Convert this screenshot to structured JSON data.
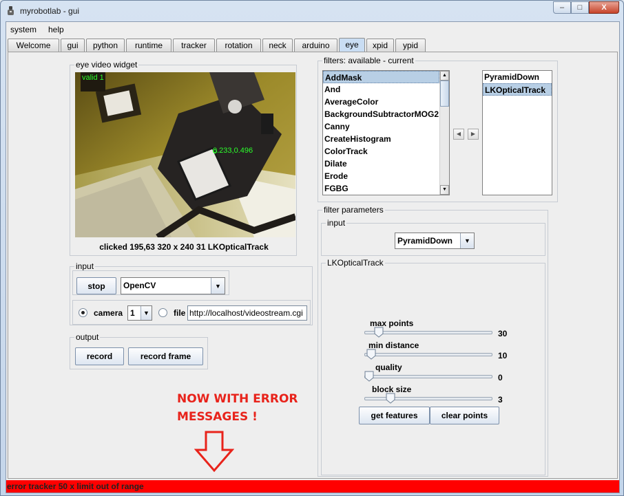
{
  "window": {
    "title": "myrobotlab - gui",
    "min_label": "–",
    "max_label": "□",
    "close_label": "X"
  },
  "menu": [
    "system",
    "help"
  ],
  "tabs": [
    "Welcome",
    "gui",
    "python",
    "runtime",
    "tracker",
    "rotation",
    "neck",
    "arduino",
    "eye",
    "xpid",
    "ypid"
  ],
  "active_tab": "eye",
  "video_widget": {
    "title": "eye  video widget",
    "overlay_valid": "valid 1",
    "overlay_point": "0.233,0.496",
    "info": "clicked 195,63  320 x 240  31  LKOpticalTrack"
  },
  "input": {
    "title": "input",
    "stop_label": "stop",
    "source_selected": "OpenCV",
    "camera_label": "camera",
    "camera_index": "1",
    "file_label": "file",
    "file_value": "http://localhost/videostream.cgi",
    "camera_selected": true
  },
  "output": {
    "title": "output",
    "record_label": "record",
    "record_frame_label": "record frame"
  },
  "annotation": {
    "line1": "NOW WITH ERROR",
    "line2": "MESSAGES !"
  },
  "filters": {
    "title": "filters: available - current",
    "available": [
      "AddMask",
      "And",
      "AverageColor",
      "BackgroundSubtractorMOG2",
      "Canny",
      "CreateHistogram",
      "ColorTrack",
      "Dilate",
      "Erode",
      "FGBG"
    ],
    "available_selected": "AddMask",
    "current": [
      "PyramidDown",
      "LKOpticalTrack"
    ],
    "current_selected": "LKOpticalTrack"
  },
  "filter_parameters": {
    "title": "filter parameters",
    "input_title": "input",
    "input_selected": "PyramidDown",
    "lk_title": "LKOpticalTrack",
    "sliders": [
      {
        "label": "max points",
        "value": "30",
        "fraction": 0.08
      },
      {
        "label": "min distance",
        "value": "10",
        "fraction": 0.02
      },
      {
        "label": "quality",
        "value": "0",
        "fraction": 0.0
      },
      {
        "label": "block size",
        "value": "3",
        "fraction": 0.18
      }
    ],
    "get_features_label": "get features",
    "clear_points_label": "clear points"
  },
  "status": {
    "message": "error tracker 50 x limit out of range",
    "color": "#ff0000"
  }
}
